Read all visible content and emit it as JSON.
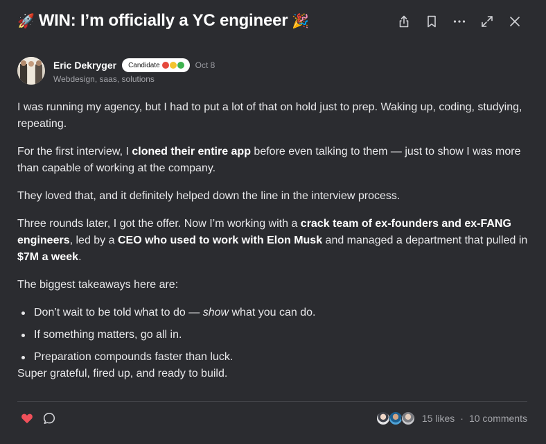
{
  "post": {
    "title_prefix_emoji": "🚀",
    "title": "WIN: I’m officially a YC engineer",
    "title_suffix_emoji": "🎉"
  },
  "actions": {
    "share": "share-icon",
    "bookmark": "bookmark-icon",
    "more": "more-icon",
    "expand": "expand-icon",
    "close": "close-icon"
  },
  "author": {
    "name": "Eric Dekryger",
    "badge_label": "Candidate",
    "badge_dots": [
      "#e5483c",
      "#f3c32e",
      "#3fb34f"
    ],
    "date": "Oct 8",
    "subtitle": "Webdesign, saas, solutions"
  },
  "body": {
    "p1": "I was running my agency, but I had to put a lot of that on hold just to prep. Waking up, coding, studying, repeating.",
    "p2_a": "For the first interview, I ",
    "p2_b": "cloned their entire app",
    "p2_c": " before even talking to them — just to show I was more than capable of working at the company.",
    "p3": "They loved that, and it definitely helped down the line in the interview process.",
    "p4_a": "Three rounds later, I got the offer. Now I’m working with a ",
    "p4_b": "crack team of ex-founders and ex-FANG engineers",
    "p4_c": ", led by a ",
    "p4_d": "CEO who used to work with Elon Musk",
    "p4_e": " and managed a department that pulled in ",
    "p4_f": "$7M a week",
    "p4_g": ".",
    "p5": "The biggest takeaways here are:",
    "bullet1_a": "Don’t wait to be told what to do — ",
    "bullet1_b": "show",
    "bullet1_c": " what you can do.",
    "bullet2": "If something matters, go all in.",
    "bullet3": "Preparation compounds faster than luck.",
    "p6": "Super grateful, fired up, and ready to build."
  },
  "footer": {
    "like_color": "#f0505a",
    "likes": "15 likes",
    "separator": "·",
    "comments": "10 comments"
  }
}
